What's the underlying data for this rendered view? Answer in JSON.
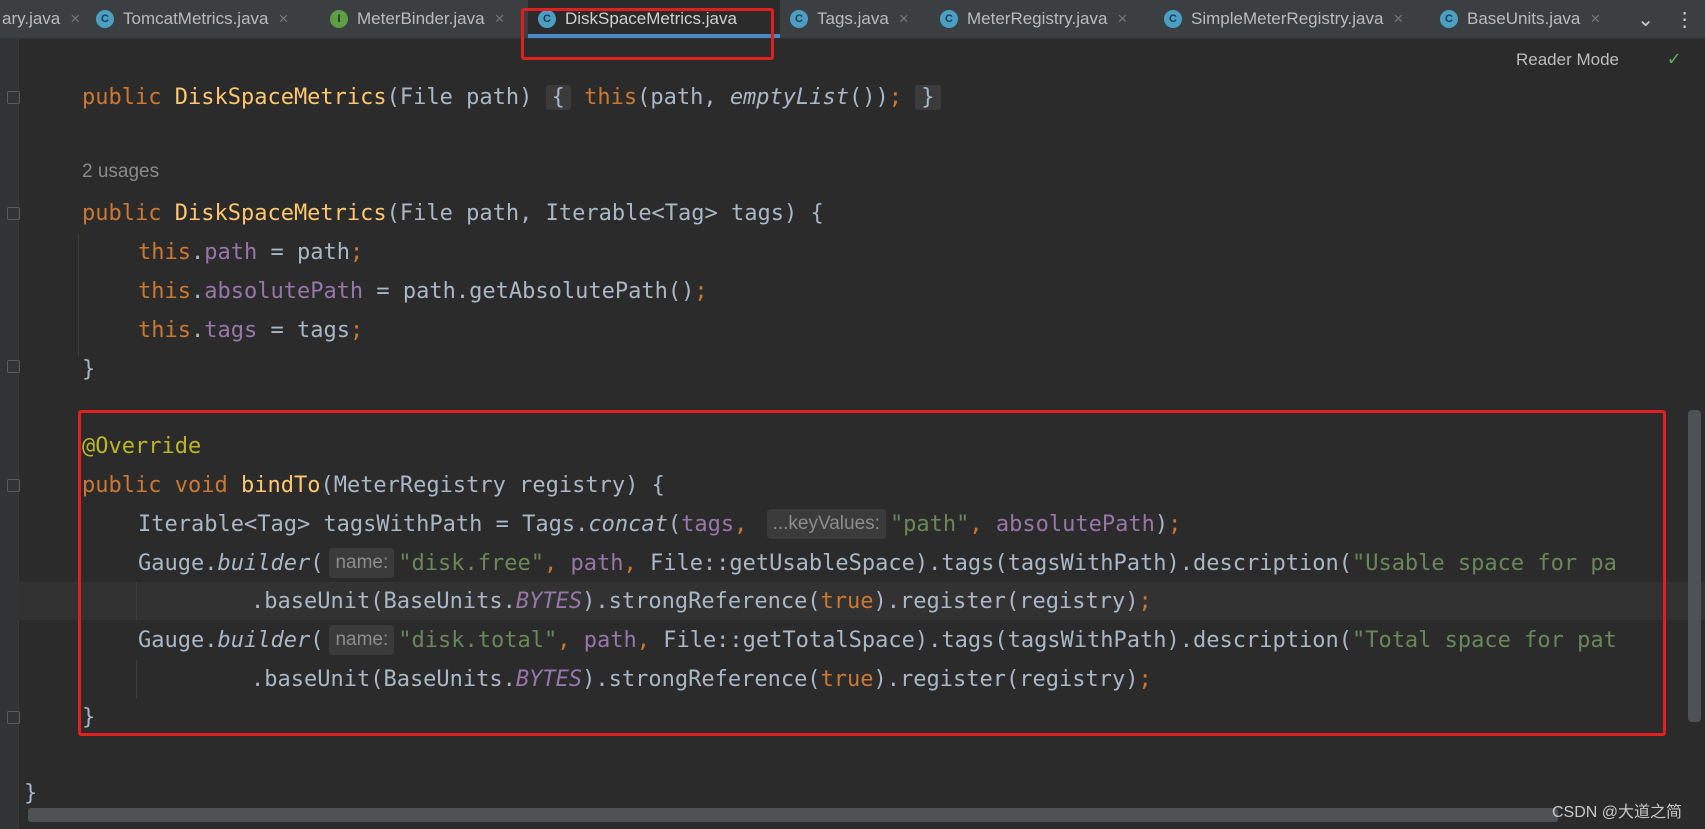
{
  "tabs": [
    {
      "label": "ary.java",
      "icon": "class-icon",
      "active": false
    },
    {
      "label": "TomcatMetrics.java",
      "icon": "class-icon",
      "active": false
    },
    {
      "label": "MeterBinder.java",
      "icon": "interface-icon",
      "active": false
    },
    {
      "label": "DiskSpaceMetrics.java",
      "icon": "class-icon",
      "active": true
    },
    {
      "label": "Tags.java",
      "icon": "class-icon",
      "active": false
    },
    {
      "label": "MeterRegistry.java",
      "icon": "class-icon",
      "active": false
    },
    {
      "label": "SimpleMeterRegistry.java",
      "icon": "class-icon",
      "active": false
    },
    {
      "label": "BaseUnits.java",
      "icon": "class-icon",
      "active": false
    }
  ],
  "icons": {
    "class_letter": "C",
    "interface_letter": "I",
    "close": "×",
    "chevron": "⌄",
    "more": "⋮",
    "check": "✓"
  },
  "editor": {
    "reader_mode": "Reader Mode",
    "usages": "2 usages",
    "hints": {
      "key_values": "...keyValues:",
      "name": "name:"
    },
    "code": {
      "public": "public",
      "void": "void",
      "this": "this",
      "class_name": "DiskSpaceMetrics",
      "ctor1_params": "(File path)",
      "ctor1_open": "{",
      "ctor1_call_open": "(path, ",
      "empty_list": "emptyList",
      "ctor1_call_close": "())",
      "semicolon": ";",
      "close_brace": "}",
      "ctor2_params": "(File path, Iterable<Tag> tags) {",
      "dot": ".",
      "path": "path",
      "assign_path": " = path",
      "absolute_path": "absolutePath",
      "assign_abs": " = path.getAbsolutePath()",
      "tags": "tags",
      "assign_tags": " = tags",
      "override": "@Override",
      "bind_to": "bindTo",
      "bind_params": "(MeterRegistry registry) {",
      "iter_decl": "Iterable<Tag> tagsWithPath = Tags.",
      "concat": "concat",
      "paren_open": "(",
      "comma": ", ",
      "str_path": "\"path\"",
      "close_paren_semi": ")",
      "gauge": "Gauge.",
      "builder": "builder",
      "str_disk_free": "\"disk.free\"",
      "usable_ref": "File::getUsableSpace).tags(tagsWithPath).description(",
      "str_usable": "\"Usable space for pa",
      "base_unit_a": ".baseUnit(BaseUnits.",
      "bytes": "BYTES",
      "strong_ref": ").strongReference(",
      "true": "true",
      "register": ").register(registry)",
      "str_disk_total": "\"disk.total\"",
      "total_ref": "File::getTotalSpace).tags(tagsWithPath).description(",
      "str_total": "\"Total space for pat"
    }
  },
  "watermark": "CSDN @大道之简"
}
